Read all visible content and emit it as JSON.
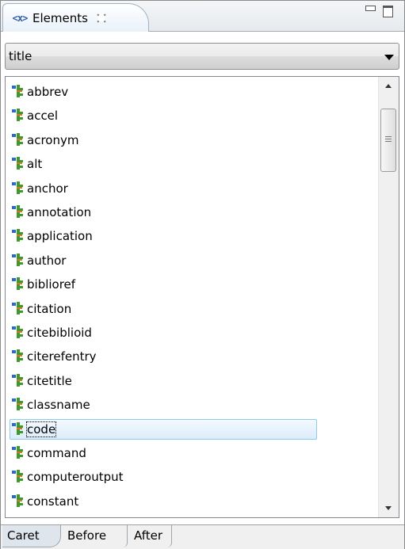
{
  "view": {
    "icon": "elements-view-icon",
    "icon_text": "<x>",
    "title": "Elements"
  },
  "combo": {
    "selected": "title"
  },
  "list": {
    "items": [
      "abbrev",
      "accel",
      "acronym",
      "alt",
      "anchor",
      "annotation",
      "application",
      "author",
      "biblioref",
      "citation",
      "citebiblioid",
      "citerefentry",
      "citetitle",
      "classname",
      "code",
      "command",
      "computeroutput",
      "constant"
    ],
    "selected_index": 14
  },
  "bottom_tabs": [
    "Caret",
    "Before",
    "After"
  ],
  "colors": {
    "accent_blue": "#2a6cc8",
    "selection_border": "#8ecbe9"
  }
}
